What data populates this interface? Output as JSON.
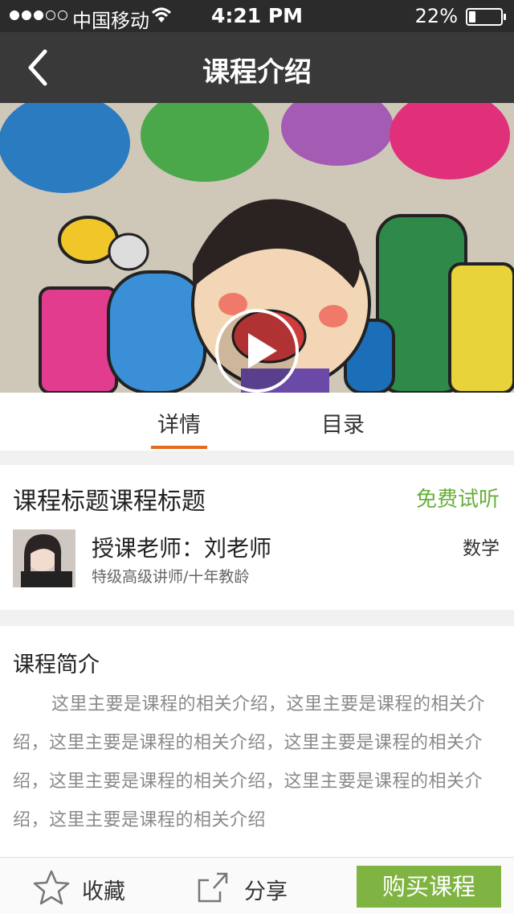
{
  "status_bar": {
    "carrier": "中国移动",
    "time": "4:21 PM",
    "battery_percent": "22%",
    "battery_level": 0.22,
    "signal_bars_filled": 3,
    "signal_bars_total": 5
  },
  "nav": {
    "title": "课程介绍",
    "back_icon": "chevron-left-icon"
  },
  "banner": {
    "play_icon": "play-icon"
  },
  "tabs": [
    {
      "label": "详情",
      "active": true
    },
    {
      "label": "目录",
      "active": false
    }
  ],
  "course": {
    "title": "课程标题课程标题",
    "trial_label": "免费试听",
    "teacher_name": "授课老师：刘老师",
    "teacher_desc": "特级高级讲师/十年教龄",
    "subject": "数学"
  },
  "intro": {
    "heading": "课程简介",
    "body": "这里主要是课程的相关介绍，这里主要是课程的相关介绍，这里主要是课程的相关介绍，这里主要是课程的相关介绍，这里主要是课程的相关介绍，这里主要是课程的相关介绍，这里主要是课程的相关介绍"
  },
  "bottom_bar": {
    "favorite_label": "收藏",
    "share_label": "分享",
    "buy_label": "购买课程"
  },
  "colors": {
    "accent_orange": "#e36b1a",
    "green": "#68b03a",
    "buy_button": "#7fb342",
    "nav_bg": "#393939"
  }
}
